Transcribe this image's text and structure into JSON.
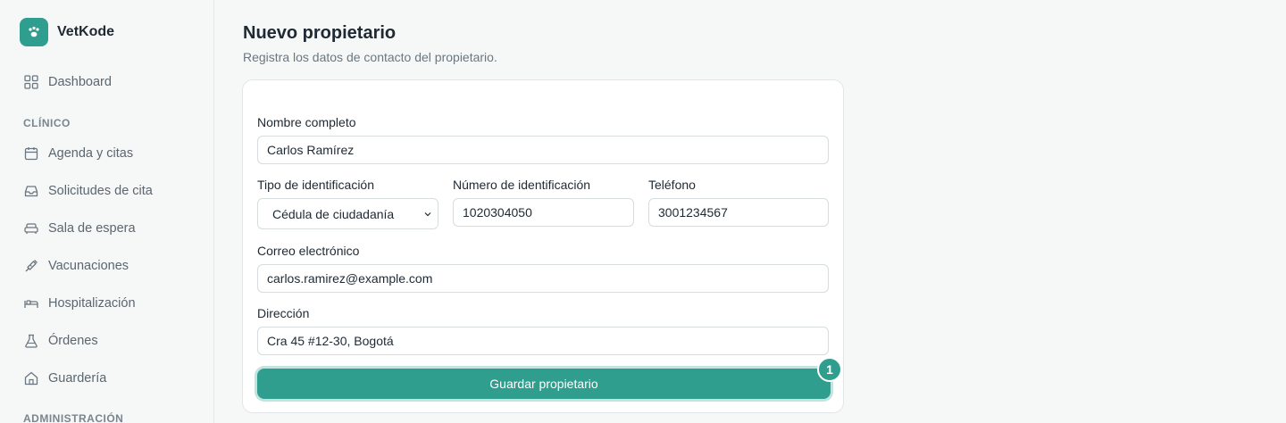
{
  "app": {
    "name": "VetKode"
  },
  "sidebar": {
    "dashboard": "Dashboard",
    "section_clinico": "CLÍNICO",
    "items": [
      {
        "label": "Agenda y citas",
        "icon": "calendar-icon"
      },
      {
        "label": "Solicitudes de cita",
        "icon": "inbox-icon"
      },
      {
        "label": "Sala de espera",
        "icon": "sofa-icon"
      },
      {
        "label": "Vacunaciones",
        "icon": "syringe-icon"
      },
      {
        "label": "Hospitalización",
        "icon": "bed-icon"
      },
      {
        "label": "Órdenes",
        "icon": "flask-icon"
      },
      {
        "label": "Guardería",
        "icon": "home-icon"
      }
    ],
    "section_admin": "ADMINISTRACIÓN"
  },
  "page": {
    "title": "Nuevo propietario",
    "subtitle": "Registra los datos de contacto del propietario."
  },
  "form": {
    "nombre_label": "Nombre completo",
    "nombre_value": "Carlos Ramírez",
    "tipo_label": "Tipo de identificación",
    "tipo_value": "Cédula de ciudadanía",
    "numero_label": "Número de identificación",
    "numero_value": "1020304050",
    "telefono_label": "Teléfono",
    "telefono_value": "3001234567",
    "correo_label": "Correo electrónico",
    "correo_value": "carlos.ramirez@example.com",
    "direccion_label": "Dirección",
    "direccion_value": "Cra 45 #12-30, Bogotá",
    "save_label": "Guardar propietario",
    "badge": "1"
  },
  "colors": {
    "accent": "#2f9e8f",
    "accent_ring": "#bfe5de"
  }
}
